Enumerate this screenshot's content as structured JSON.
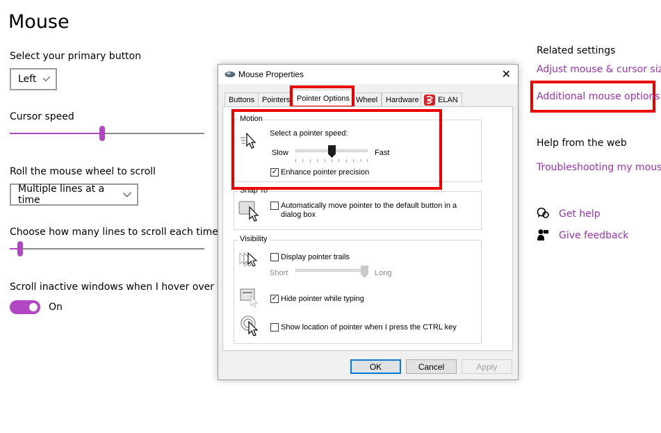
{
  "page": {
    "title": "Mouse",
    "primary_button": {
      "label": "Select your primary button",
      "value": "Left"
    },
    "cursor_speed": {
      "label": "Cursor speed",
      "level": 0.47
    },
    "scroll": {
      "label": "Roll the mouse wheel to scroll",
      "value": "Multiple lines at a time"
    },
    "lines": {
      "label": "Choose how many lines to scroll each time",
      "level": 0.05
    },
    "inactive": {
      "label": "Scroll inactive windows when I hover over them",
      "state": "On"
    }
  },
  "related": {
    "heading": "Related settings",
    "links": [
      "Adjust mouse & cursor size",
      "Additional mouse options"
    ],
    "help_heading": "Help from the web",
    "help_link": "Troubleshooting my mouse",
    "get_help": "Get help",
    "give_feedback": "Give feedback"
  },
  "dialog": {
    "title": "Mouse Properties",
    "close": "✕",
    "tabs": [
      "Buttons",
      "Pointers",
      "Pointer Options",
      "Wheel",
      "Hardware",
      "ELAN"
    ],
    "motion": {
      "title": "Motion",
      "speed_label": "Select a pointer speed:",
      "slow": "Slow",
      "fast": "Fast",
      "speed_level": 0.5,
      "precision_label": "Enhance pointer precision",
      "precision_checked": "✓"
    },
    "snap": {
      "title": "Snap To",
      "line1": "Automatically move pointer to the default button in a",
      "line2": "dialog box"
    },
    "visibility": {
      "title": "Visibility",
      "trails_label": "Display pointer trails",
      "short": "Short",
      "long": "Long",
      "trails_level": 1.0,
      "hide_label": "Hide pointer while typing",
      "hide_checked": "✓",
      "ctrl_label": "Show location of pointer when I press the CTRL key"
    },
    "buttons": {
      "ok": "OK",
      "cancel": "Cancel",
      "apply": "Apply"
    }
  },
  "colors": {
    "accent": "#b146c2",
    "link": "#9b30b0",
    "highlight": "#ec0000",
    "dialog_focus": "#0078d7"
  }
}
